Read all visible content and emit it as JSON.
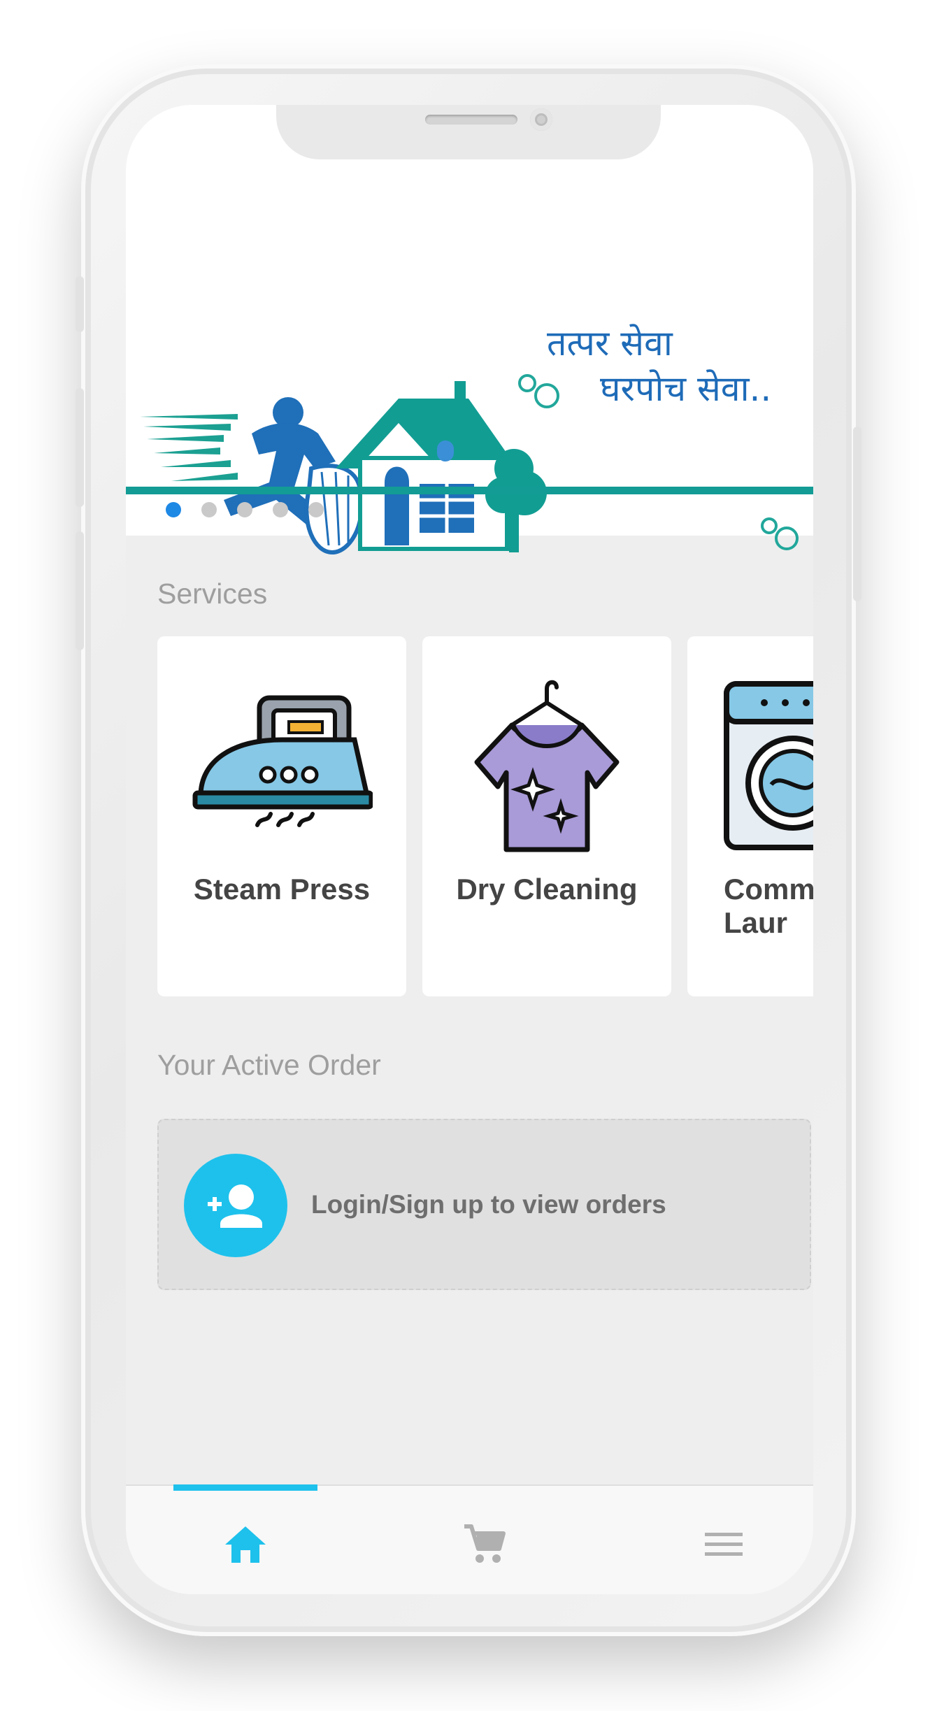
{
  "banner": {
    "tagline_line1": "तत्पर सेवा",
    "tagline_line2": "घरपोच सेवा..",
    "carousel_dots": 5,
    "active_dot": 1
  },
  "services": {
    "title": "Services",
    "items": [
      {
        "label": "Steam Press",
        "icon": "steam-iron-icon"
      },
      {
        "label": "Dry Cleaning",
        "icon": "shirt-hanger-icon"
      },
      {
        "label": "Comm\nLaur",
        "icon": "washing-machine-icon"
      }
    ]
  },
  "active_order": {
    "title": "Your Active Order",
    "message": "Login/Sign up to view orders",
    "icon": "add-user-icon"
  },
  "bottom_nav": {
    "items": [
      "home-icon",
      "cart-icon",
      "menu-icon"
    ],
    "active": "home-icon"
  },
  "colors": {
    "accent": "#1ec1ec",
    "banner_teal": "#139c95",
    "banner_blue": "#1e6bb8",
    "active_dot": "#1e88e5"
  }
}
